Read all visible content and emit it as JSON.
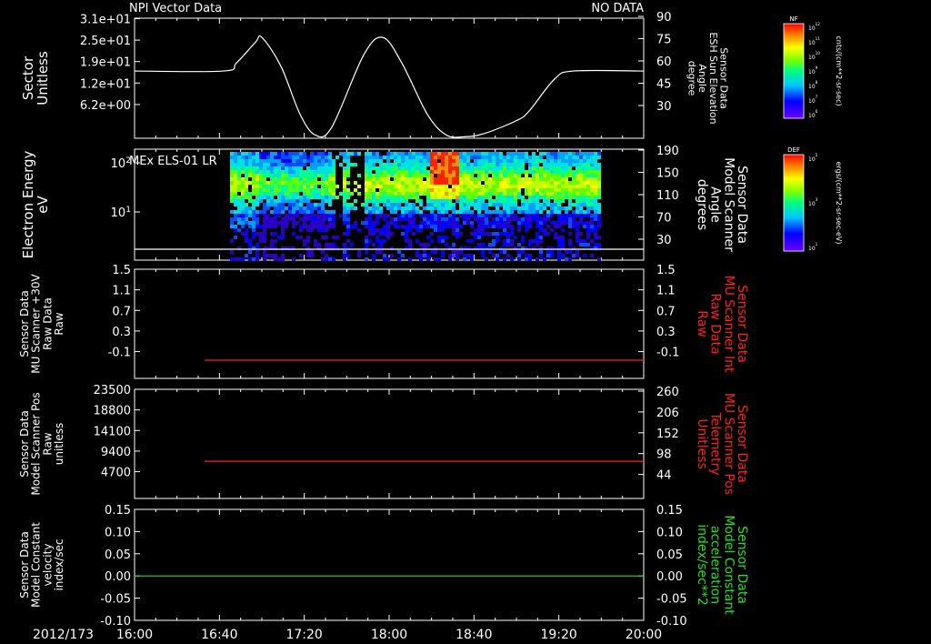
{
  "header": {
    "title": "NPI Vector Data",
    "status": "NO DATA",
    "panel2_title": "MEx ELS-01 LR"
  },
  "time_axis": {
    "date": "2012/173",
    "ticks": [
      "16:00",
      "16:40",
      "17:20",
      "18:00",
      "18:40",
      "19:20",
      "20:00"
    ]
  },
  "colors": {
    "axis": "#ffffff",
    "red": "#ff2020",
    "green": "#20e020"
  },
  "colorbars": [
    {
      "name": "NF",
      "label": "cnts/(cm**2-sr-sec)",
      "ticks": [
        "10^12",
        "10^11",
        "10^10",
        "10^9",
        "10^8",
        "10^7",
        "10^6"
      ]
    },
    {
      "name": "DEF",
      "label": "ergs/(cm**2-sr-sec-eV)",
      "ticks": [
        "10^5",
        "10^3",
        "10^1"
      ]
    }
  ],
  "chart_data": [
    {
      "type": "line",
      "left_label": [
        "Sector",
        "Unitless"
      ],
      "left_ticks": [
        "3.1e+01",
        "2.5e+01",
        "1.9e+01",
        "1.2e+01",
        "6.2e+00"
      ],
      "right_label": [
        "Sensor Data",
        "ESH Sun Elevation",
        "Angle",
        "degree"
      ],
      "right_ticks": [
        "90",
        "75",
        "60",
        "45",
        "30"
      ],
      "ylim": [
        15,
        90
      ],
      "xlim": [
        16.0,
        20.0
      ],
      "series": [
        {
          "color": "#ffffff",
          "x": [
            16.0,
            16.7,
            16.8,
            16.95,
            17.0,
            17.15,
            17.3,
            17.42,
            17.55,
            17.8,
            17.95,
            18.1,
            18.3,
            18.45,
            18.6,
            18.75,
            19.0,
            19.1,
            19.3,
            19.45,
            20.0
          ],
          "y": [
            57,
            57,
            62,
            75,
            78,
            60,
            30,
            17,
            22,
            67,
            78,
            62,
            30,
            17,
            16,
            18,
            26,
            32,
            52,
            57,
            57
          ]
        }
      ]
    },
    {
      "type": "heatmap",
      "left_label": [
        "Electron Energy",
        "eV"
      ],
      "left_ticks": [
        "10^2",
        "10^1"
      ],
      "right_label": [
        "Sensor Data",
        "Model Scanner",
        "Angle",
        "degrees"
      ],
      "right_ticks": [
        "190",
        "150",
        "110",
        "70",
        "30"
      ],
      "xlim": [
        16.0,
        20.0
      ],
      "data_range": [
        16.75,
        19.65
      ],
      "baseline_angle": 15
    },
    {
      "type": "line",
      "left_label": [
        "Sensor Data",
        "MU Scanner +30V",
        "Raw Data",
        "Raw"
      ],
      "left_ticks": [
        "1.5",
        "1.1",
        "0.7",
        "0.3",
        "-0.1"
      ],
      "right_label": [
        "Sensor Data",
        "MU Scanner Int",
        "Raw Data",
        "Raw"
      ],
      "right_ticks": [
        "1.5",
        "1.1",
        "0.7",
        "0.3",
        "-0.1"
      ],
      "ylim": [
        -0.3,
        1.5
      ],
      "series": [
        {
          "color": "#ff2020",
          "x": [
            16.55,
            20.0
          ],
          "y": [
            0.0,
            0.0
          ]
        }
      ]
    },
    {
      "type": "line",
      "left_label": [
        "Sensor Data",
        "Model Scanner Pos",
        "Raw",
        "unitless"
      ],
      "left_ticks": [
        "23500",
        "18800",
        "14100",
        "9400",
        "4700"
      ],
      "right_label": [
        "Sensor Data",
        "MU Scanner Pos",
        "Telemetry",
        "Unitless"
      ],
      "right_ticks": [
        "260",
        "206",
        "152",
        "98",
        "44"
      ],
      "ylim": [
        0,
        23500
      ],
      "series": [
        {
          "color": "#ff2020",
          "x": [
            16.55,
            20.0
          ],
          "y": [
            8000,
            8000
          ]
        }
      ]
    },
    {
      "type": "line",
      "left_label": [
        "Sensor Data",
        "Model Constant",
        "velocity",
        "index/sec"
      ],
      "left_ticks": [
        "0.15",
        "0.10",
        "0.05",
        "0.00",
        "-0.05",
        "-0.10"
      ],
      "right_label": [
        "Sensor Data",
        "Model Constant",
        "acceleration",
        "index/sec**2"
      ],
      "right_ticks": [
        "0.15",
        "0.10",
        "0.05",
        "0.00",
        "-0.05",
        "-0.10"
      ],
      "ylim": [
        -0.1,
        0.15
      ],
      "series": [
        {
          "color": "#20e020",
          "x": [
            16.0,
            20.0
          ],
          "y": [
            0.0,
            0.0
          ]
        }
      ]
    }
  ]
}
